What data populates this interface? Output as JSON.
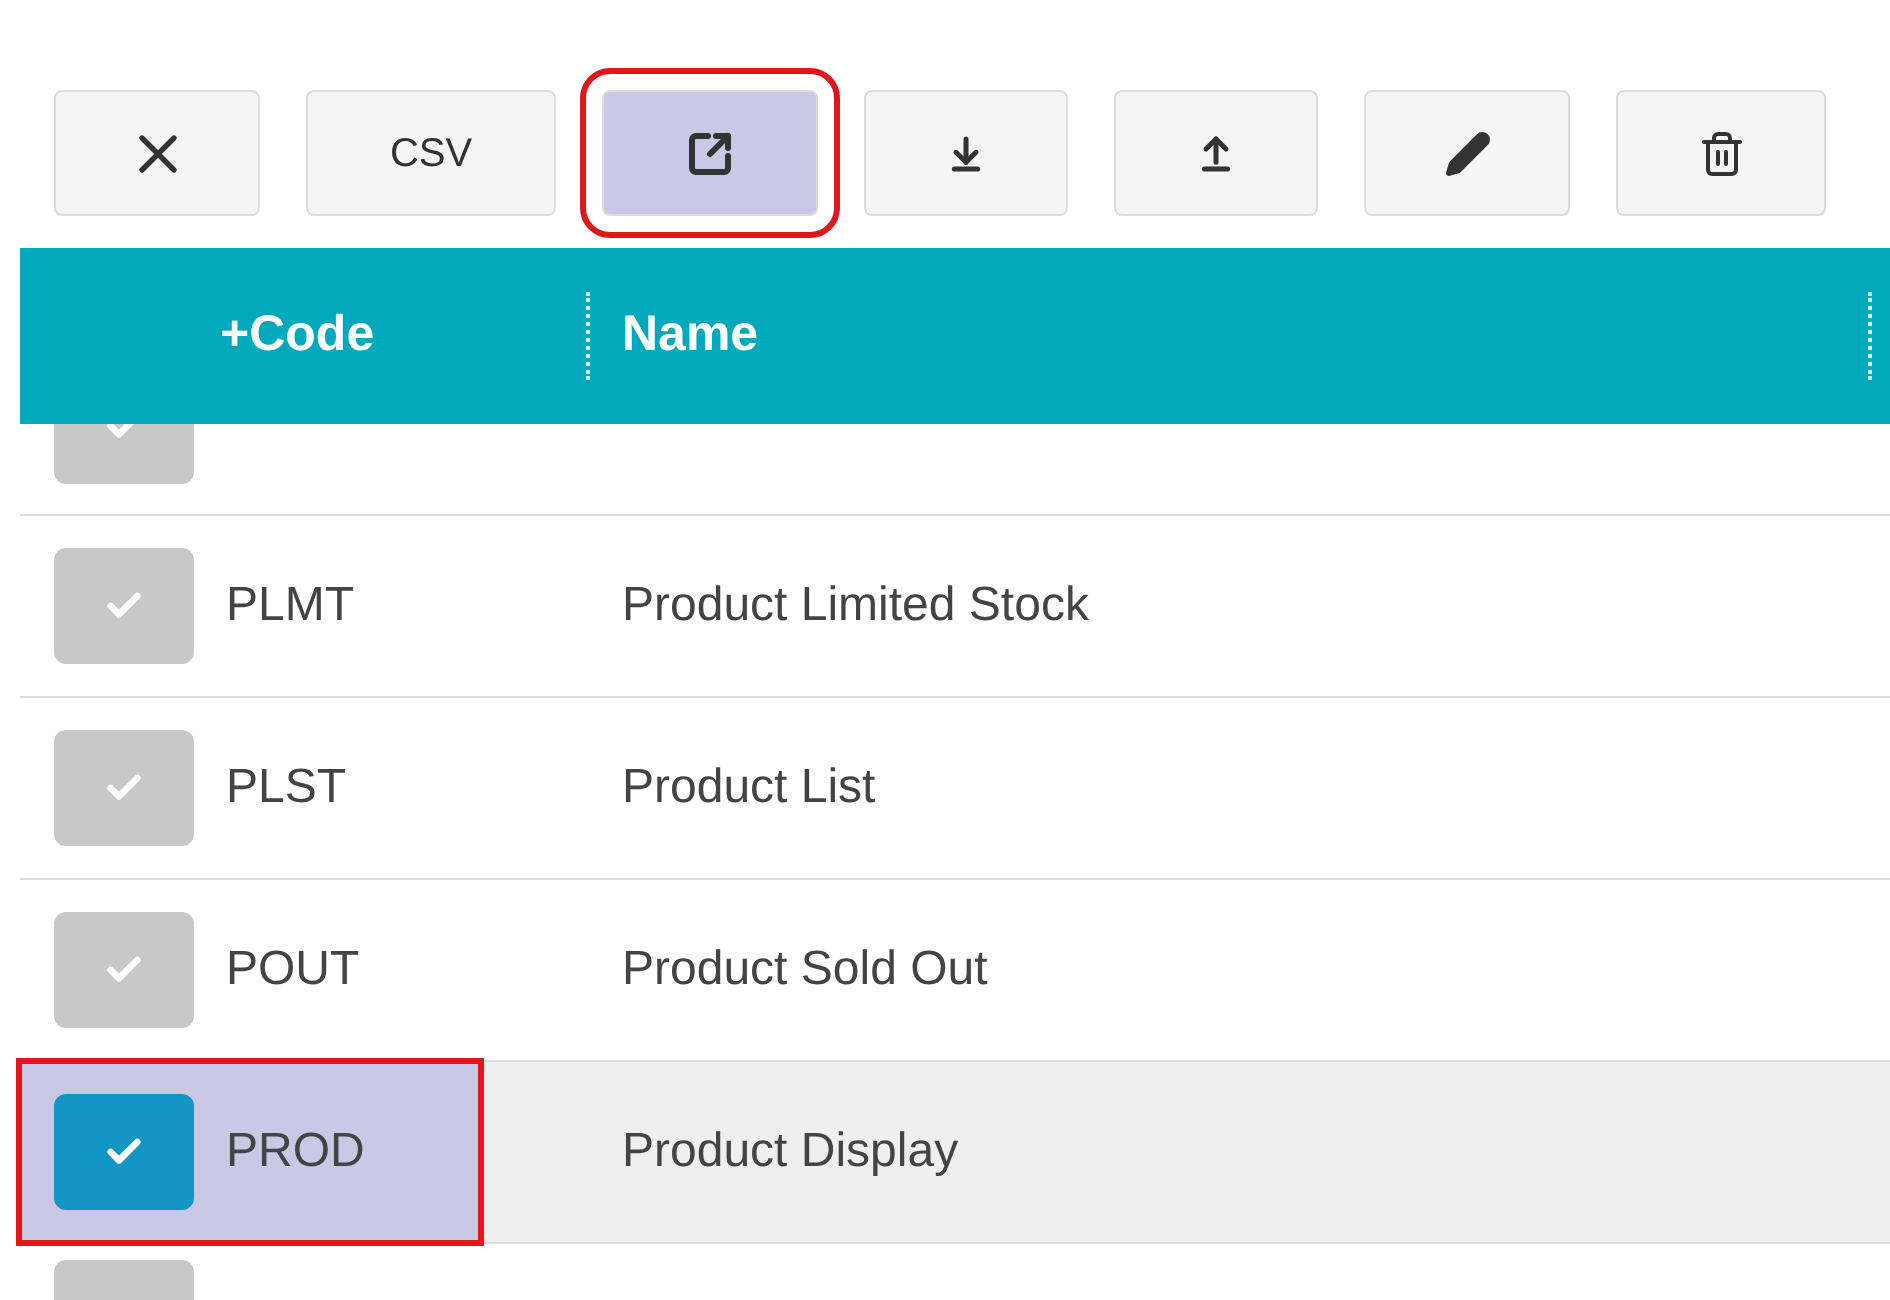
{
  "toolbar": [
    {
      "kind": "close",
      "highlighted": false
    },
    {
      "kind": "text",
      "label": "CSV",
      "highlighted": false
    },
    {
      "kind": "export",
      "highlighted": true
    },
    {
      "kind": "download",
      "highlighted": false
    },
    {
      "kind": "upload",
      "highlighted": false
    },
    {
      "kind": "edit",
      "highlighted": false
    },
    {
      "kind": "delete",
      "highlighted": false
    }
  ],
  "table": {
    "columns": [
      "+Code",
      "Name"
    ],
    "rows": [
      {
        "checked": false,
        "selected": false,
        "highlighted": false,
        "partial": true
      },
      {
        "code": "PLMT",
        "name": "Product Limited Stock",
        "checked": false,
        "selected": false,
        "highlighted": false,
        "partial": false
      },
      {
        "code": "PLST",
        "name": "Product List",
        "checked": false,
        "selected": false,
        "highlighted": false,
        "partial": false
      },
      {
        "code": "POUT",
        "name": "Product Sold Out",
        "checked": false,
        "selected": false,
        "highlighted": false,
        "partial": false
      },
      {
        "code": "PROD",
        "name": "Product Display",
        "checked": true,
        "selected": true,
        "highlighted": true,
        "partial": false
      }
    ],
    "next_row": {
      "checked": false
    }
  }
}
